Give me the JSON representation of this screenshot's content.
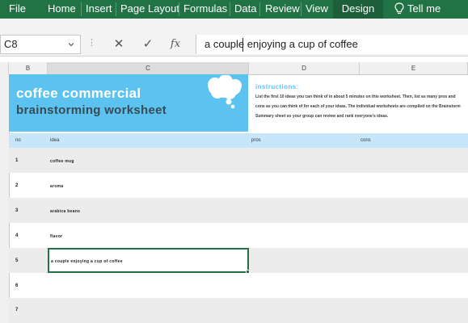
{
  "ribbon": {
    "tabs": [
      {
        "id": "file",
        "label": "File"
      },
      {
        "id": "home",
        "label": "Home"
      },
      {
        "id": "insert",
        "label": "Insert"
      },
      {
        "id": "page-layout",
        "label": "Page Layout"
      },
      {
        "id": "formulas",
        "label": "Formulas"
      },
      {
        "id": "data",
        "label": "Data"
      },
      {
        "id": "review",
        "label": "Review"
      },
      {
        "id": "view",
        "label": "View"
      },
      {
        "id": "design",
        "label": "Design"
      }
    ],
    "tell_me": "Tell me",
    "accent_color": "#217346"
  },
  "formula_bar": {
    "name_box": "C8",
    "cancel_icon": "✕",
    "enter_icon": "✓",
    "fx_label": "fx",
    "content": "a couple enjoying a cup of coffee"
  },
  "columns": [
    "B",
    "C",
    "D",
    "E"
  ],
  "banner": {
    "title": "coffee commercial",
    "subtitle": "brainstorming worksheet",
    "color": "#5cc3f0",
    "icon": "thought-cloud-icon"
  },
  "instructions": {
    "title": "instructions:",
    "text": "List the first 10 ideas you can think of in about 5 minutes on this worksheet. Then, list as many pros and cons as you can think of for each of your ideas. The individual worksheets are compiled on the Brainstorm Summary sheet so your group can review and rank everyone's ideas."
  },
  "table": {
    "headers": {
      "no": "no",
      "idea": "idea",
      "pros": "pros",
      "cons": "cons"
    },
    "rows": [
      {
        "no": "1",
        "idea": "coffee mug"
      },
      {
        "no": "2",
        "idea": "aroma"
      },
      {
        "no": "3",
        "idea": "arabica beans"
      },
      {
        "no": "4",
        "idea": "flavor"
      },
      {
        "no": "5",
        "idea": "a couple enjoying a cup of coffee"
      },
      {
        "no": "6",
        "idea": ""
      },
      {
        "no": "7",
        "idea": ""
      }
    ]
  }
}
